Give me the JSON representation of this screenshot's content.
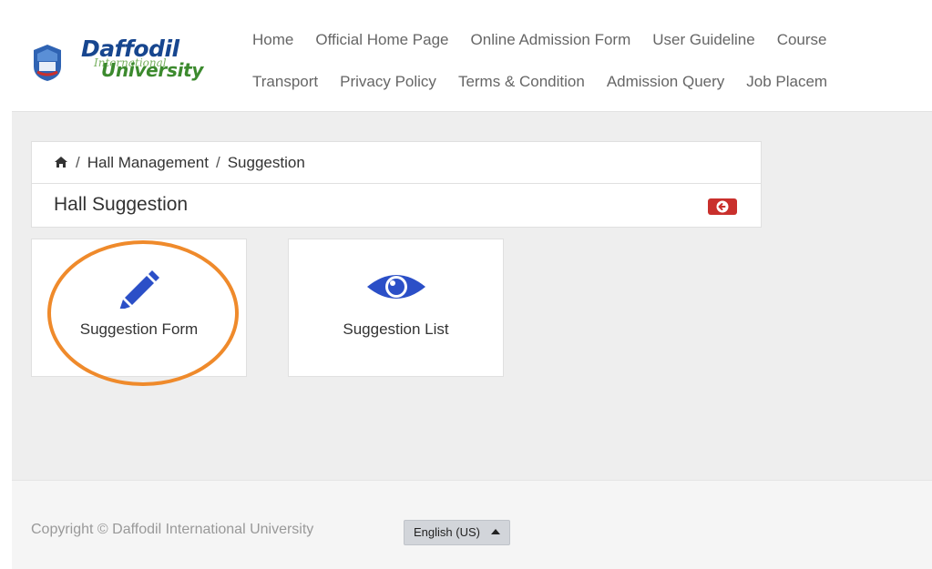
{
  "brand": {
    "line1": "Daffodil",
    "line2": "International",
    "line3": "University"
  },
  "nav": {
    "row1": [
      "Home",
      "Official Home Page",
      "Online Admission Form",
      "User Guideline",
      "Course"
    ],
    "row2": [
      "Transport",
      "Privacy Policy",
      "Terms & Condition",
      "Admission Query",
      "Job Placem"
    ]
  },
  "breadcrumb": {
    "items": [
      "Hall Management",
      "Suggestion"
    ],
    "separator": "/"
  },
  "page": {
    "title": "Hall Suggestion"
  },
  "tiles": [
    {
      "label": "Suggestion Form",
      "icon": "pencil-icon"
    },
    {
      "label": "Suggestion List",
      "icon": "eye-icon"
    }
  ],
  "footer": {
    "copyright": "Copyright © Daffodil International University",
    "language": "English (US)"
  },
  "colors": {
    "brand_blue": "#17468f",
    "brand_green": "#3c8a2e",
    "icon_blue": "#2b4fc7",
    "back_red": "#c9302c",
    "highlight_orange": "#ef8a2b"
  }
}
